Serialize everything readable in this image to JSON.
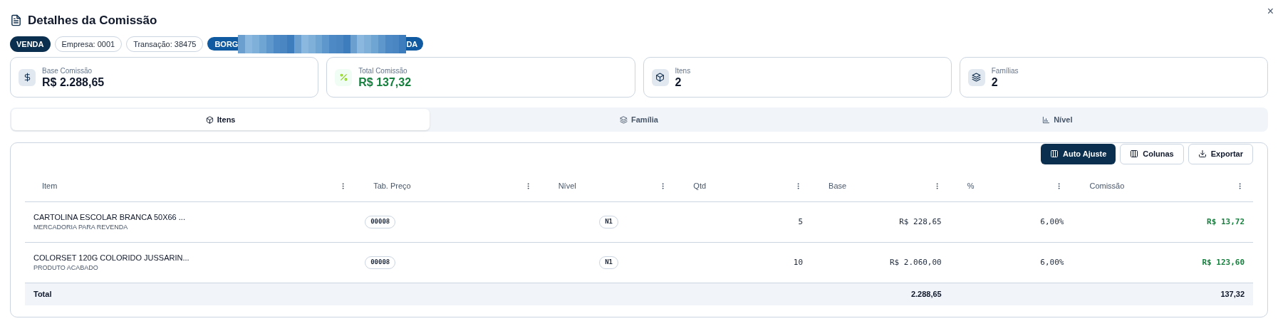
{
  "title": "Detalhes da Comissão",
  "close": "×",
  "badges": [
    {
      "kind": "type",
      "text": "VENDA"
    },
    {
      "kind": "outline",
      "text": "Empresa: 0001"
    },
    {
      "kind": "outline",
      "text": "Transação: 38475"
    },
    {
      "kind": "redacted",
      "text_start": "BORG",
      "text_end": "DA"
    }
  ],
  "cards": [
    {
      "kind": "dollar",
      "label": "Base Comissão",
      "value": "R$ 2.288,65",
      "highlight": false
    },
    {
      "kind": "percent",
      "label": "Total Comissão",
      "value": "R$ 137,32",
      "highlight": true
    },
    {
      "kind": "box",
      "label": "Itens",
      "value": "2",
      "highlight": false
    },
    {
      "kind": "layers",
      "label": "Famílias",
      "value": "2",
      "highlight": false
    }
  ],
  "tabs": [
    {
      "kind": "box",
      "label": "Itens",
      "selected": true
    },
    {
      "kind": "layers",
      "label": "Família",
      "selected": false
    },
    {
      "kind": "chart",
      "label": "Nível",
      "selected": false
    }
  ],
  "toolbar": [
    {
      "label": "Auto Ajuste",
      "kind": "columns",
      "primary": true
    },
    {
      "label": "Colunas",
      "kind": "columns",
      "primary": false
    },
    {
      "label": "Exportar",
      "kind": "download",
      "primary": false
    }
  ],
  "table": {
    "columns": [
      "Item",
      "Tab. Preço",
      "Nível",
      "Qtd",
      "Base",
      "%",
      "Comissão"
    ],
    "rows": [
      {
        "item": "CARTOLINA ESCOLAR BRANCA 50X66 ...",
        "category": "MERCADORIA PARA REVENDA",
        "price_table": "00008",
        "level": "N1",
        "qty": "5",
        "base": "R$ 228,65",
        "percent": "6,00%",
        "commission": "R$ 13,72"
      },
      {
        "item": "COLORSET 120G COLORIDO JUSSARIN...",
        "category": "PRODUTO ACABADO",
        "price_table": "00008",
        "level": "N1",
        "qty": "10",
        "base": "R$ 2.060,00",
        "percent": "6,00%",
        "commission": "R$ 123,60"
      }
    ],
    "total": {
      "label": "Total",
      "base": "2.288,65",
      "commission": "137,32"
    }
  }
}
